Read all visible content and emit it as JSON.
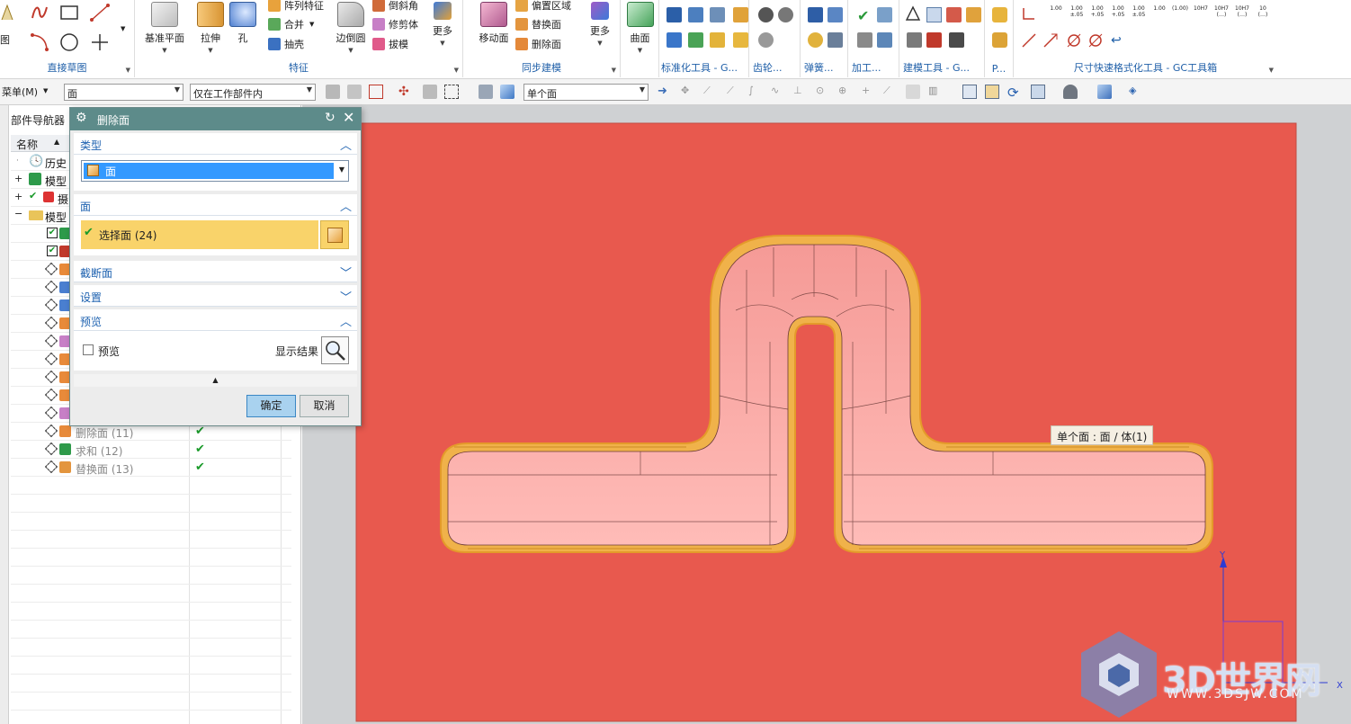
{
  "ribbon": {
    "direct_sketch": {
      "group_label": "直接草图",
      "partial_label": "图"
    },
    "feature": {
      "group_label": "特征",
      "datum_plane": "基准平面",
      "extrude": "拉伸",
      "hole": "孔",
      "pattern_feature": "阵列特征",
      "combine": "合并",
      "shell": "抽壳",
      "edge_blend": "边倒圆",
      "chamfer": "倒斜角",
      "trim_body": "修剪体",
      "draft": "拔模",
      "more": "更多"
    },
    "sync_modeling": {
      "group_label": "同步建模",
      "move_face": "移动面",
      "offset_region": "偏置区域",
      "replace_face": "替换面",
      "delete_face": "删除面",
      "more": "更多"
    },
    "surface": {
      "label": "曲面"
    },
    "small_groups": {
      "standard_tools": "标准化工具 - G...",
      "gear": "齿轮...",
      "spring": "弹簧...",
      "machining": "加工...",
      "modeling_tools": "建模工具 - G...",
      "p_short": "P...",
      "dimension_tools": "尺寸快速格式化工具 - GC工具箱"
    },
    "dim_formats": [
      "1.00",
      "1.00\n±.05",
      "1.00\n+.05",
      "1.00\n+.05",
      "1.00\n±.05",
      "1.00",
      "(1.00)",
      "10H7",
      "10H7\n(…)",
      "10H7\n(…)",
      "10\n(…)"
    ]
  },
  "toolbar2": {
    "menu_label": "菜单(M)",
    "type_filter": "面",
    "scope": "仅在工作部件内",
    "face_rule": "单个面"
  },
  "navigator": {
    "tab_label": "部件导航器",
    "column_name": "名称",
    "rows": [
      {
        "label": "历史"
      },
      {
        "label": "模型"
      },
      {
        "label": "摄"
      },
      {
        "label": "模型"
      },
      {
        "label": "删除面 (11)"
      },
      {
        "label": "求和 (12)"
      },
      {
        "label": "替换面 (13)"
      }
    ]
  },
  "dialog": {
    "title": "删除面",
    "sections": {
      "type": "类型",
      "face": "面",
      "cross_section": "截断面",
      "settings": "设置",
      "preview": "预览"
    },
    "type_value": "面",
    "select_face": "选择面 (24)",
    "preview_checkbox": "预览",
    "show_result": "显示结果",
    "ok": "确定",
    "cancel": "取消"
  },
  "viewport": {
    "tooltip": "单个面 : 面 / 体(1)",
    "axis_y": "Y",
    "axis_x": "X"
  },
  "watermark": {
    "title": "3D世界网",
    "url": "WWW.3DSJW.COM"
  },
  "colors": {
    "part_body": "#e8594e",
    "pocket_fill": "#f6a3a0",
    "pocket_rim": "#f0b24a",
    "dialog_title": "#5d8b8a",
    "selection_bar": "#f9d36a",
    "link_blue": "#1e62b0"
  }
}
